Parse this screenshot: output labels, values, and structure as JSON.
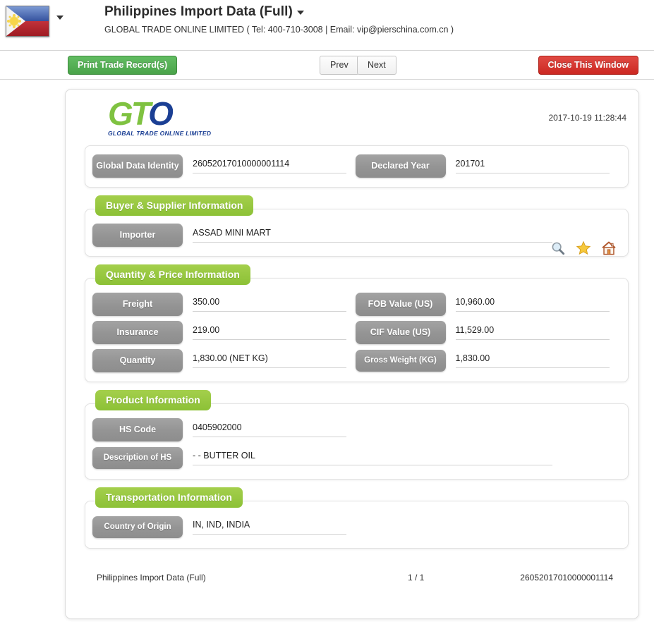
{
  "header": {
    "flag_icon": "philippines-flag-icon",
    "flag_caret_icon": "chevron-down-icon",
    "title": "Philippines Import Data (Full)",
    "title_caret_icon": "chevron-down-icon",
    "subtitle": "GLOBAL TRADE ONLINE LIMITED ( Tel: 400-710-3008 | Email: vip@pierschina.com.cn )"
  },
  "toolbar": {
    "print_label": "Print Trade Record(s)",
    "prev_label": "Prev",
    "next_label": "Next",
    "close_label": "Close This Window"
  },
  "document": {
    "logo": {
      "mark_g": "G",
      "mark_t": "T",
      "mark_o": "O",
      "subtext": "GLOBAL TRADE  ONLINE LIMITED"
    },
    "timestamp": "2017-10-19 11:28:44",
    "identity": {
      "fields": [
        {
          "label": "Global Data Identity",
          "value": "26052017010000001114"
        },
        {
          "label": "Declared Year",
          "value": "201701"
        }
      ]
    },
    "sections": [
      {
        "title": "Buyer & Supplier Information",
        "fields": [
          {
            "label": "Importer",
            "value": "ASSAD MINI MART"
          }
        ],
        "icons": [
          {
            "name": "search-icon",
            "label": "Search"
          },
          {
            "name": "star-icon",
            "label": "Favorite"
          },
          {
            "name": "home-icon",
            "label": "Home"
          }
        ]
      },
      {
        "title": "Quantity & Price Information",
        "fields": [
          {
            "label": "Freight",
            "value": "350.00"
          },
          {
            "label": "FOB Value (US)",
            "value": "10,960.00"
          },
          {
            "label": "Insurance",
            "value": "219.00"
          },
          {
            "label": "CIF Value (US)",
            "value": "11,529.00"
          },
          {
            "label": "Quantity",
            "value": "1,830.00 (NET KG)"
          },
          {
            "label": "Gross Weight (KG)",
            "value": "1,830.00"
          }
        ]
      },
      {
        "title": "Product Information",
        "fields": [
          {
            "label": "HS Code",
            "value": "0405902000"
          },
          {
            "label": "Description of HS",
            "value": "- - BUTTER OIL"
          }
        ]
      },
      {
        "title": "Transportation Information",
        "fields": [
          {
            "label": "Country of Origin",
            "value": "IN, IND, INDIA"
          }
        ]
      }
    ],
    "footer": {
      "left": "Philippines Import Data (Full)",
      "page": "1 / 1",
      "right": "26052017010000001114"
    }
  },
  "colors": {
    "section_green": "#8cc136",
    "pill_gray": "#949494",
    "print_green": "#4aa34a",
    "close_red": "#cc2822",
    "logo_green": "#7fc241",
    "logo_blue": "#1b3f94"
  }
}
